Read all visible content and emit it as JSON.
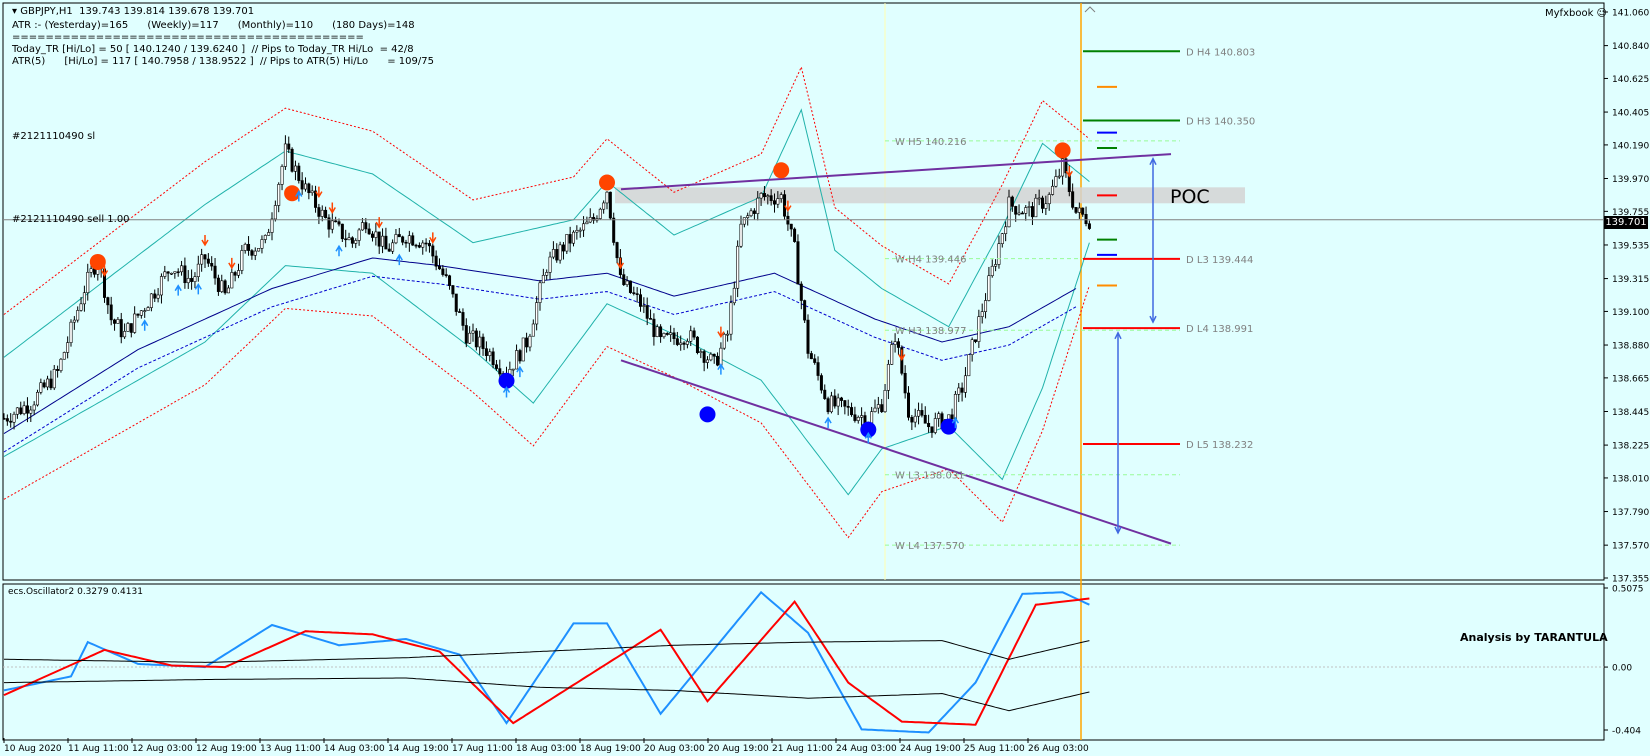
{
  "header": {
    "symbol_line": "GBPJPY,H1  139.743 139.814 139.678 139.701",
    "atr_line": "ATR :- (Yesterday)=165      (Weekly)=117      (Monthly)=110      (180 Days)=148",
    "separator": "==========================================",
    "today_tr_line": "Today_TR [Hi/Lo] = 50 [ 140.1240 / 139.6240 ]  // Pips to Today_TR Hi/Lo  = 42/8",
    "atr5_line": "ATR(5)      [Hi/Lo] = 117 [ 140.7958 / 138.9522 ]  // Pips to ATR(5) Hi/Lo      = 109/75",
    "brand": "Myfxbook"
  },
  "orders": {
    "sl_label": "#2121110490 sl",
    "sell_label": "#2121110490 sell 1.00"
  },
  "poc_label": "POC",
  "credit": "Analysis by TARANTULA",
  "current_price": "139.701",
  "colors": {
    "background": "#e0ffff",
    "up_marker": "#ff4500",
    "down_marker": "#0000ff",
    "trend": "#7030a0",
    "level_red": "#ff0000",
    "level_green": "#008000",
    "osc_blue": "#1e90ff",
    "osc_red": "#ff0000"
  },
  "chart_data": [
    {
      "type": "candlestick",
      "ylim": [
        137.355,
        141.06
      ],
      "y_ticks": [
        "141.060",
        "140.840",
        "140.625",
        "140.405",
        "140.190",
        "139.970",
        "139.755",
        "139.535",
        "139.315",
        "139.100",
        "138.880",
        "138.665",
        "138.445",
        "138.225",
        "138.010",
        "137.790",
        "137.570",
        "137.355"
      ],
      "x_ticks": [
        "10 Aug 2020",
        "11 Aug 11:00",
        "12 Aug 03:00",
        "12 Aug 19:00",
        "13 Aug 11:00",
        "14 Aug 03:00",
        "14 Aug 19:00",
        "17 Aug 11:00",
        "18 Aug 03:00",
        "18 Aug 19:00",
        "20 Aug 03:00",
        "20 Aug 19:00",
        "21 Aug 11:00",
        "24 Aug 03:00",
        "24 Aug 19:00",
        "25 Aug 11:00",
        "26 Aug 03:00"
      ],
      "close_path": [
        [
          0,
          138.4
        ],
        [
          8,
          138.5
        ],
        [
          16,
          138.7
        ],
        [
          24,
          139.25
        ],
        [
          28,
          139.45
        ],
        [
          32,
          139.05
        ],
        [
          36,
          138.95
        ],
        [
          44,
          139.2
        ],
        [
          50,
          139.4
        ],
        [
          56,
          139.3
        ],
        [
          60,
          139.45
        ],
        [
          66,
          139.2
        ],
        [
          72,
          139.5
        ],
        [
          78,
          139.55
        ],
        [
          84,
          140.15
        ],
        [
          90,
          139.9
        ],
        [
          96,
          139.7
        ],
        [
          104,
          139.55
        ],
        [
          108,
          139.7
        ],
        [
          114,
          139.5
        ],
        [
          120,
          139.6
        ],
        [
          126,
          139.55
        ],
        [
          132,
          139.3
        ],
        [
          138,
          138.95
        ],
        [
          144,
          138.85
        ],
        [
          150,
          138.7
        ],
        [
          156,
          138.9
        ],
        [
          162,
          139.4
        ],
        [
          168,
          139.55
        ],
        [
          176,
          139.7
        ],
        [
          180,
          139.9
        ],
        [
          184,
          139.3
        ],
        [
          190,
          139.15
        ],
        [
          196,
          138.9
        ],
        [
          204,
          138.95
        ],
        [
          212,
          138.75
        ],
        [
          216,
          138.95
        ],
        [
          220,
          139.65
        ],
        [
          226,
          139.85
        ],
        [
          232,
          139.85
        ],
        [
          236,
          139.5
        ],
        [
          240,
          138.85
        ],
        [
          246,
          138.5
        ],
        [
          252,
          138.45
        ],
        [
          258,
          138.4
        ],
        [
          262,
          138.5
        ],
        [
          266,
          138.95
        ],
        [
          270,
          138.45
        ],
        [
          276,
          138.35
        ],
        [
          282,
          138.4
        ],
        [
          286,
          138.6
        ],
        [
          290,
          138.95
        ],
        [
          296,
          139.45
        ],
        [
          300,
          139.8
        ],
        [
          306,
          139.75
        ],
        [
          312,
          139.85
        ],
        [
          316,
          140.05
        ],
        [
          320,
          139.75
        ],
        [
          324,
          139.7
        ]
      ],
      "bollinger_upper": [
        [
          0,
          138.8
        ],
        [
          60,
          139.8
        ],
        [
          84,
          140.15
        ],
        [
          110,
          140.0
        ],
        [
          140,
          139.55
        ],
        [
          170,
          139.7
        ],
        [
          180,
          139.95
        ],
        [
          200,
          139.6
        ],
        [
          226,
          139.85
        ],
        [
          238,
          140.42
        ],
        [
          248,
          139.5
        ],
        [
          262,
          139.25
        ],
        [
          282,
          139.0
        ],
        [
          298,
          139.65
        ],
        [
          310,
          140.2
        ],
        [
          324,
          139.95
        ]
      ],
      "bollinger_lower": [
        [
          0,
          138.15
        ],
        [
          60,
          138.9
        ],
        [
          84,
          139.4
        ],
        [
          110,
          139.35
        ],
        [
          140,
          138.85
        ],
        [
          158,
          138.5
        ],
        [
          180,
          139.15
        ],
        [
          200,
          138.95
        ],
        [
          226,
          138.65
        ],
        [
          252,
          137.9
        ],
        [
          262,
          138.2
        ],
        [
          282,
          138.35
        ],
        [
          298,
          138.0
        ],
        [
          310,
          138.6
        ],
        [
          324,
          139.55
        ]
      ],
      "moving_average": [
        [
          0,
          138.3
        ],
        [
          40,
          138.85
        ],
        [
          80,
          139.25
        ],
        [
          110,
          139.45
        ],
        [
          130,
          139.4
        ],
        [
          160,
          139.3
        ],
        [
          180,
          139.35
        ],
        [
          200,
          139.2
        ],
        [
          230,
          139.35
        ],
        [
          260,
          139.05
        ],
        [
          280,
          138.9
        ],
        [
          300,
          139.0
        ],
        [
          320,
          139.25
        ]
      ],
      "trendlines": [
        {
          "from": [
            180,
            139.9
          ],
          "to": [
            340,
            140.13
          ]
        },
        {
          "from": [
            180,
            138.78
          ],
          "to": [
            340,
            137.58
          ]
        }
      ],
      "levels": [
        {
          "label": "D  H4 140.803",
          "price": 140.803,
          "color": "#008000"
        },
        {
          "label": "D  H3 140.350",
          "price": 140.35,
          "color": "#008000"
        },
        {
          "label": "D  L3 139.444",
          "price": 139.444,
          "color": "#ff0000"
        },
        {
          "label": "D  L4 138.991",
          "price": 138.991,
          "color": "#ff0000"
        },
        {
          "label": "D  L5 138.232",
          "price": 138.232,
          "color": "#ff0000"
        }
      ],
      "weekly_levels": [
        {
          "label": "W  H5 140.216",
          "price": 140.216
        },
        {
          "label": "W  H4 139.446",
          "price": 139.446
        },
        {
          "label": "W  H3 138.977",
          "price": 138.977
        },
        {
          "label": "W  L3 138.031",
          "price": 138.031
        },
        {
          "label": "W  L4 137.570",
          "price": 137.57
        }
      ],
      "swing_highs": [
        [
          28,
          139.45
        ],
        [
          86,
          139.9
        ],
        [
          180,
          139.97
        ],
        [
          232,
          140.05
        ],
        [
          316,
          140.18
        ]
      ],
      "swing_lows": [
        [
          150,
          138.62
        ],
        [
          210,
          138.4
        ],
        [
          258,
          138.3
        ],
        [
          282,
          138.32
        ]
      ],
      "poc_price": 139.86,
      "sell_price": 139.7
    },
    {
      "type": "line",
      "title": "ecs.Oscillator2 0.3279 0.4131",
      "ylim": [
        -0.404,
        0.5075
      ],
      "y_ticks": [
        "0.5075",
        "0.00",
        "-0.404"
      ],
      "series": [
        {
          "color": "#1e90ff",
          "values": [
            [
              0,
              -0.15
            ],
            [
              20,
              -0.06
            ],
            [
              25,
              0.16
            ],
            [
              40,
              0.02
            ],
            [
              60,
              0.0
            ],
            [
              80,
              0.27
            ],
            [
              100,
              0.14
            ],
            [
              120,
              0.18
            ],
            [
              136,
              0.08
            ],
            [
              150,
              -0.36
            ],
            [
              170,
              0.28
            ],
            [
              180,
              0.28
            ],
            [
              196,
              -0.3
            ],
            [
              226,
              0.48
            ],
            [
              240,
              0.22
            ],
            [
              256,
              -0.4
            ],
            [
              276,
              -0.42
            ],
            [
              290,
              -0.1
            ],
            [
              304,
              0.47
            ],
            [
              316,
              0.48
            ],
            [
              324,
              0.4
            ]
          ]
        },
        {
          "color": "#ff0000",
          "values": [
            [
              0,
              -0.18
            ],
            [
              30,
              0.11
            ],
            [
              50,
              0.01
            ],
            [
              66,
              0.0
            ],
            [
              90,
              0.23
            ],
            [
              110,
              0.21
            ],
            [
              130,
              0.1
            ],
            [
              152,
              -0.36
            ],
            [
              196,
              0.24
            ],
            [
              210,
              -0.22
            ],
            [
              236,
              0.42
            ],
            [
              252,
              -0.1
            ],
            [
              268,
              -0.35
            ],
            [
              290,
              -0.37
            ],
            [
              308,
              0.4
            ],
            [
              324,
              0.44
            ]
          ]
        },
        {
          "color": "#000000",
          "values": [
            [
              0,
              0.05
            ],
            [
              60,
              0.03
            ],
            [
              120,
              0.06
            ],
            [
              160,
              0.1
            ],
            [
              200,
              0.14
            ],
            [
              240,
              0.16
            ],
            [
              280,
              0.17
            ],
            [
              300,
              0.05
            ],
            [
              324,
              0.17
            ]
          ]
        },
        {
          "color": "#000000",
          "values": [
            [
              0,
              -0.1
            ],
            [
              60,
              -0.08
            ],
            [
              120,
              -0.07
            ],
            [
              160,
              -0.13
            ],
            [
              200,
              -0.15
            ],
            [
              240,
              -0.2
            ],
            [
              280,
              -0.17
            ],
            [
              300,
              -0.28
            ],
            [
              324,
              -0.16
            ]
          ]
        }
      ]
    }
  ]
}
